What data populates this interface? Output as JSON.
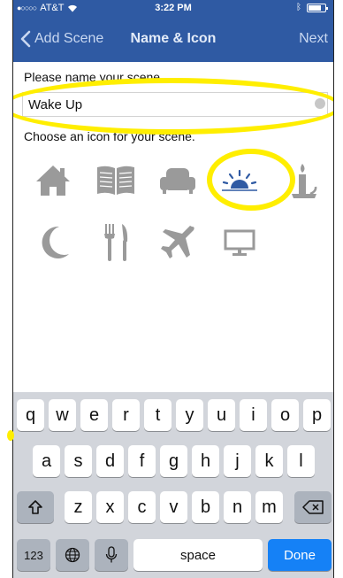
{
  "status_bar": {
    "carrier": "AT&T",
    "time": "3:22 PM"
  },
  "nav": {
    "back_label": "Add Scene",
    "title": "Name & Icon",
    "next_label": "Next"
  },
  "form": {
    "name_label": "Please name your scene",
    "name_value": "Wake Up",
    "icon_label": "Choose an icon for your scene."
  },
  "icons": [
    {
      "name": "house-icon",
      "selected": false
    },
    {
      "name": "book-icon",
      "selected": false
    },
    {
      "name": "armchair-icon",
      "selected": false
    },
    {
      "name": "sunrise-icon",
      "selected": true
    },
    {
      "name": "candle-icon",
      "selected": false
    },
    {
      "name": "moon-icon",
      "selected": false
    },
    {
      "name": "fork-knife-icon",
      "selected": false
    },
    {
      "name": "airplane-icon",
      "selected": false
    },
    {
      "name": "monitor-icon",
      "selected": false
    }
  ],
  "keyboard": {
    "row1": [
      "q",
      "w",
      "e",
      "r",
      "t",
      "y",
      "u",
      "i",
      "o",
      "p"
    ],
    "row2": [
      "a",
      "s",
      "d",
      "f",
      "g",
      "h",
      "j",
      "k",
      "l"
    ],
    "row3": [
      "z",
      "x",
      "c",
      "v",
      "b",
      "n",
      "m"
    ],
    "numbers_label": "123",
    "space_label": "space",
    "done_label": "Done"
  },
  "colors": {
    "nav_bar": "#2f5aa3",
    "icon_gray": "#9a9a9a",
    "icon_selected": "#2f5aa3",
    "highlight": "#ffee00",
    "done_key": "#1581f6"
  }
}
